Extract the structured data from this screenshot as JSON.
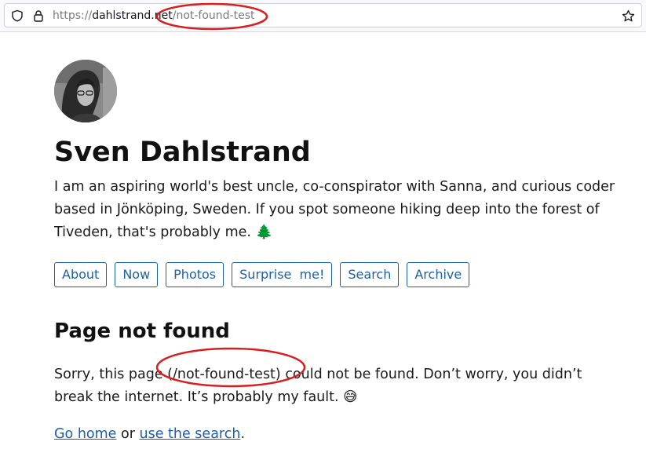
{
  "browser": {
    "url_scheme": "https://",
    "url_domain": "dahlstrand.net",
    "url_path": "/not-found-test",
    "icons": [
      "shield-icon",
      "lock-icon",
      "bookmark-star-icon"
    ]
  },
  "site": {
    "title": "Sven Dahlstrand",
    "bio": "I am an aspiring world's best uncle, co-conspirator with Sanna, and curious coder based in Jönköping, Sweden. If you spot someone hiking deep into the forest of Tiveden, that's probably me. 🌲",
    "nav": [
      {
        "label": "About"
      },
      {
        "label": "Now"
      },
      {
        "label": "Photos"
      },
      {
        "label": "Surprise  me!"
      },
      {
        "label": "Search"
      },
      {
        "label": "Archive"
      }
    ]
  },
  "not_found": {
    "heading": "Page not found",
    "message": "Sorry, this page (/not-found-test) could not be found. Don’t worry, you didn’t break the internet. It’s probably my fault. 😅",
    "go_home": "Go home",
    "or_text": " or ",
    "use_search": "use the search",
    "period": "."
  },
  "colors": {
    "link": "#1d5fa6",
    "annotation": "#d81e1e"
  }
}
